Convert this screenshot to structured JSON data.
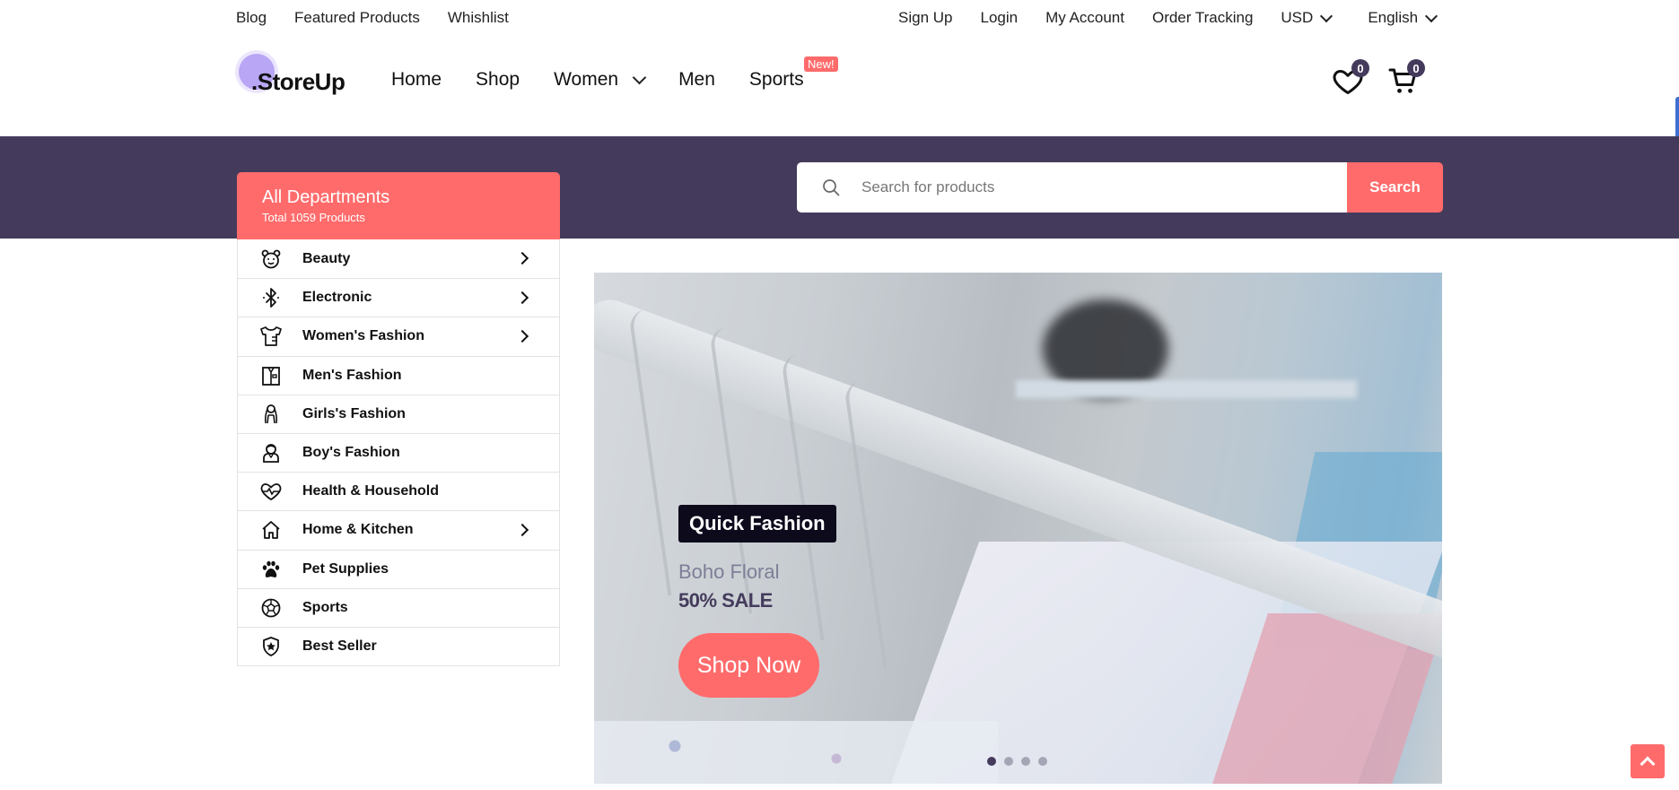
{
  "topbar": {
    "left_links": [
      "Blog",
      "Featured Products",
      "Whishlist"
    ],
    "signup": "Sign Up",
    "login": "Login",
    "account": "My Account",
    "tracking": "Order Tracking",
    "currency": "USD",
    "language": "English"
  },
  "header": {
    "logo": ".StoreUp",
    "nav": {
      "home": "Home",
      "shop": "Shop",
      "women": "Women",
      "men": "Men",
      "sports": "Sports",
      "new_badge": "New!"
    },
    "wishlist_count": "0",
    "cart_count": "0"
  },
  "departments": {
    "title": "All Departments",
    "subtitle": "Total 1059 Products",
    "items": [
      {
        "label": "Beauty",
        "icon": "bear-icon",
        "has_submenu": true
      },
      {
        "label": "Electronic",
        "icon": "bluetooth-icon",
        "has_submenu": true
      },
      {
        "label": "Women's Fashion",
        "icon": "dress-icon",
        "has_submenu": true
      },
      {
        "label": "Men's Fashion",
        "icon": "shirt-icon",
        "has_submenu": false
      },
      {
        "label": "Girls's Fashion",
        "icon": "girl-icon",
        "has_submenu": false
      },
      {
        "label": "Boy's Fashion",
        "icon": "boy-icon",
        "has_submenu": false
      },
      {
        "label": "Health & Household",
        "icon": "heartbeat-icon",
        "has_submenu": false
      },
      {
        "label": "Home & Kitchen",
        "icon": "home-icon",
        "has_submenu": true
      },
      {
        "label": "Pet Supplies",
        "icon": "paw-icon",
        "has_submenu": false
      },
      {
        "label": "Sports",
        "icon": "soccer-ball-icon",
        "has_submenu": false
      },
      {
        "label": "Best Seller",
        "icon": "star-shield-icon",
        "has_submenu": false
      }
    ]
  },
  "search": {
    "placeholder": "Search for products",
    "button": "Search"
  },
  "hero": {
    "tag": "Quick Fashion",
    "subtitle": "Boho Floral",
    "sale": "50% SALE",
    "cta": "Shop Now",
    "slides": 4,
    "active_slide": 1
  },
  "colors": {
    "accent": "#ff6b6b",
    "band": "#443b5c",
    "tag_bg": "#0d0a1c",
    "logo_dot": "#b9a6f5"
  }
}
